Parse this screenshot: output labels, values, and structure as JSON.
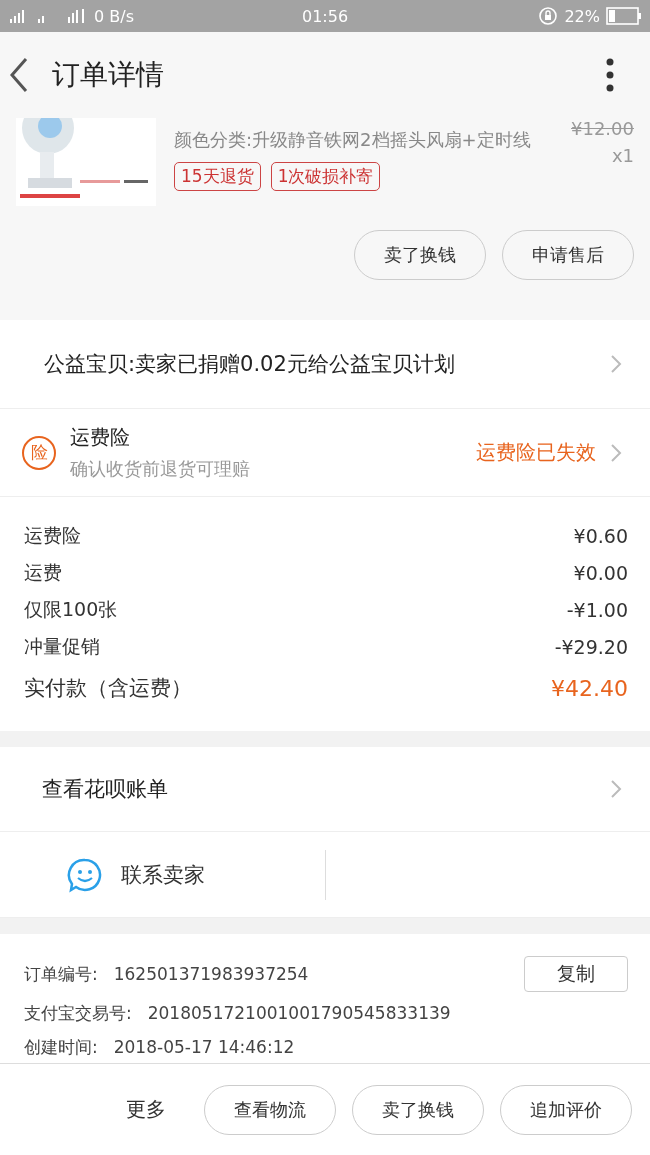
{
  "status_bar": {
    "net_speed": "0 B/s",
    "time": "01:56",
    "battery": "22%"
  },
  "header": {
    "title": "订单详情"
  },
  "product": {
    "sku": "颜色分类:升级静音铁网2档摇头风扇+定时线",
    "original_price": "¥12.00",
    "quantity": "x1",
    "tags": [
      "15天退货",
      "1次破损补寄"
    ],
    "buttons": [
      "卖了换钱",
      "申请售后"
    ]
  },
  "charity": {
    "text": "公益宝贝:卖家已捐赠0.02元给公益宝贝计划"
  },
  "insurance": {
    "badge": "险",
    "title": "运费险",
    "subtitle": "确认收货前退货可理赔",
    "status": "运费险已失效"
  },
  "fees": [
    {
      "kind": "line",
      "label": "运费险",
      "amount": "¥0.60"
    },
    {
      "kind": "line",
      "label": "运费",
      "amount": "¥0.00"
    },
    {
      "kind": "line",
      "label": "仅限100张",
      "amount": "-¥1.00"
    },
    {
      "kind": "line",
      "label": "冲量促销",
      "amount": "-¥29.20"
    },
    {
      "kind": "total",
      "label": "实付款（含运费）",
      "amount": "¥42.40"
    }
  ],
  "huabei": {
    "text": "查看花呗账单"
  },
  "contact": {
    "text": "联系卖家"
  },
  "order_info": {
    "rows": [
      {
        "label": "订单编号:",
        "value": "162501371983937254"
      },
      {
        "label": "支付宝交易号:",
        "value": "2018051721001001790545833139"
      },
      {
        "label": "创建时间:",
        "value": "2018-05-17 14:46:12"
      }
    ],
    "copy_button": "复制"
  },
  "bottom_bar": {
    "more": "更多",
    "buttons": [
      "查看物流",
      "卖了换钱",
      "追加评价"
    ]
  }
}
